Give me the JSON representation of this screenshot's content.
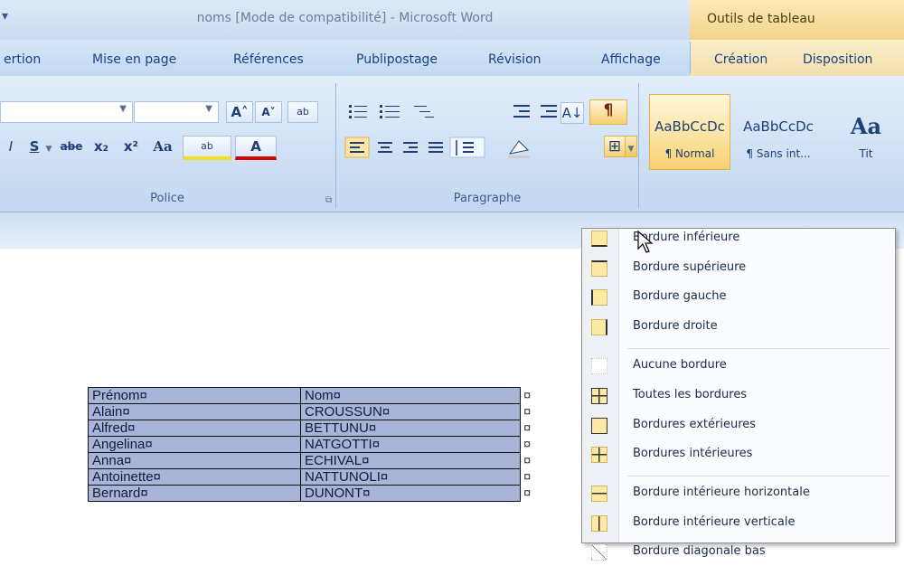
{
  "window": {
    "title": "noms [Mode de compatibilité] - Microsoft Word",
    "contextual_group": "Outils de tableau",
    "qa_glyph": "▾"
  },
  "tabs": [
    "ertion",
    "Mise en page",
    "Références",
    "Publipostage",
    "Révision",
    "Affichage",
    "Création",
    "Disposition"
  ],
  "ribbon": {
    "police": {
      "label": "Police",
      "grow": "A˄",
      "shrink": "A˅",
      "clear": "ab",
      "italic": "I",
      "strike_u": "S",
      "strike": "abe",
      "sub": "x₂",
      "sup": "x²",
      "case": "Aa",
      "highlight": "ab",
      "color": "A",
      "launcher": "⧉"
    },
    "paragraphe": {
      "label": "Paragraphe",
      "sort": "A↓",
      "pilcrow": "¶",
      "borders": "⊞"
    },
    "styles": [
      {
        "sample": "AaBbCcDc",
        "name": "¶ Normal"
      },
      {
        "sample": "AaBbCcDc",
        "name": "¶ Sans int..."
      },
      {
        "sample": "Aa",
        "name": "Tit"
      }
    ]
  },
  "table": {
    "rows": [
      [
        "Prénom¤",
        "Nom¤"
      ],
      [
        "Alain¤",
        "CROUSSUN¤"
      ],
      [
        "Alfred¤",
        "BETTUNU¤"
      ],
      [
        "Angelina¤",
        "NATGOTTI¤"
      ],
      [
        "Anna¤",
        "ECHIVAL¤"
      ],
      [
        "Antoinette¤",
        "NATTUNOLI¤"
      ],
      [
        "Bernard¤",
        "DUNONT¤"
      ]
    ],
    "end_mark": "¤"
  },
  "border_menu": {
    "items": [
      {
        "label": "Bordure inférieure",
        "icon": "border-bottom-icon"
      },
      {
        "label": "Bordure supérieure",
        "icon": "border-top-icon"
      },
      {
        "label": "Bordure gauche",
        "icon": "border-left-icon"
      },
      {
        "label": "Bordure droite",
        "icon": "border-right-icon"
      },
      {
        "label": "Aucune bordure",
        "icon": "no-border-icon"
      },
      {
        "label": "Toutes les bordures",
        "icon": "all-borders-icon"
      },
      {
        "label": "Bordures extérieures",
        "icon": "outside-borders-icon"
      },
      {
        "label": "Bordures intérieures",
        "icon": "inside-borders-icon"
      },
      {
        "label": "Bordure intérieure horizontale",
        "icon": "inside-horizontal-border-icon"
      },
      {
        "label": "Bordure intérieure verticale",
        "icon": "inside-vertical-border-icon"
      },
      {
        "label": "Bordure diagonale bas",
        "icon": "diagonal-down-border-icon"
      }
    ]
  }
}
